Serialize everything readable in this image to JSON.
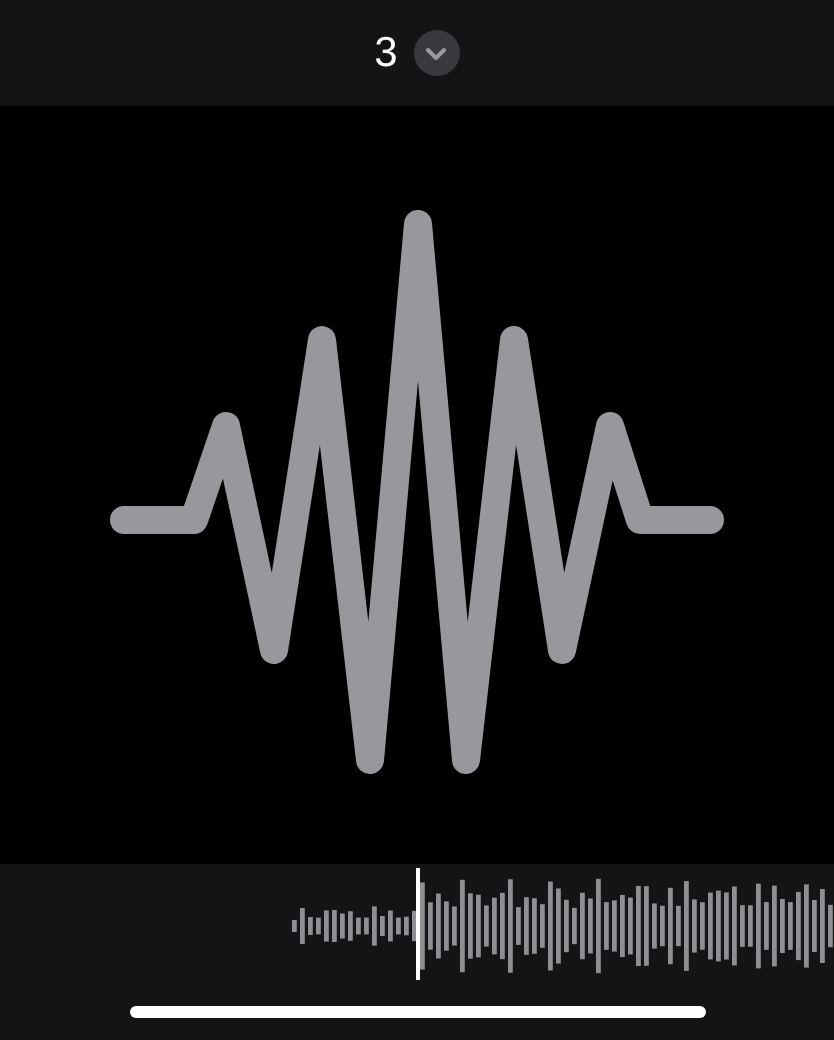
{
  "header": {
    "title": "3"
  }
}
